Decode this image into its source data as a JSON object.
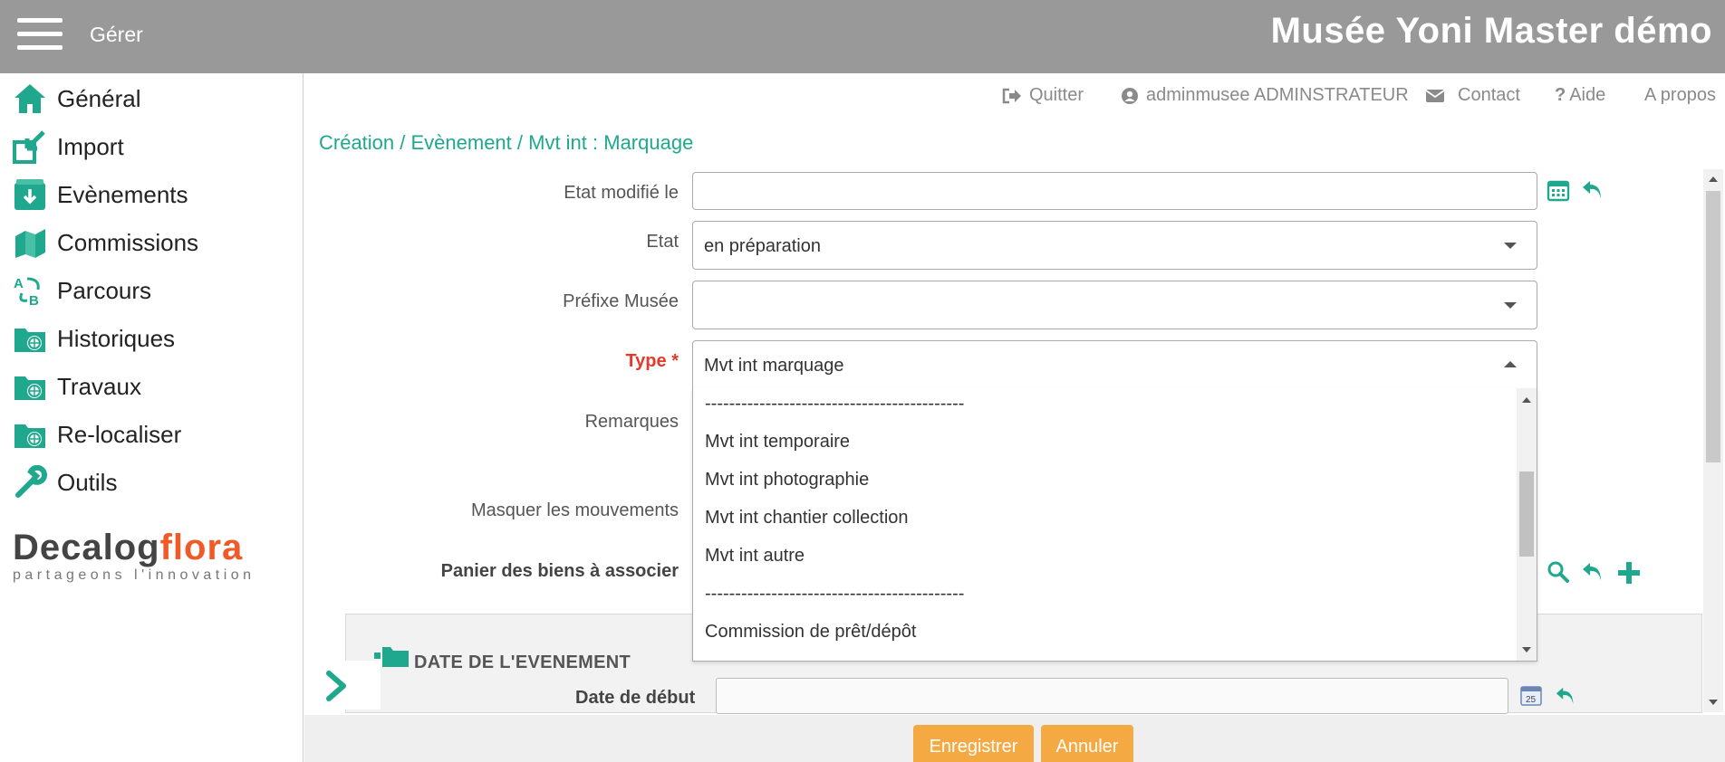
{
  "header": {
    "menu_label": "Gérer",
    "app_title": "Musée Yoni Master démo"
  },
  "sidebar": {
    "items": [
      {
        "label": "Général",
        "icon": "home-icon"
      },
      {
        "label": "Import",
        "icon": "import-icon"
      },
      {
        "label": "Evènements",
        "icon": "events-icon"
      },
      {
        "label": "Commissions",
        "icon": "commissions-icon"
      },
      {
        "label": "Parcours",
        "icon": "route-icon"
      },
      {
        "label": "Historiques",
        "icon": "history-folder-icon"
      },
      {
        "label": "Travaux",
        "icon": "works-folder-icon"
      },
      {
        "label": "Re-localiser",
        "icon": "relocate-folder-icon"
      },
      {
        "label": "Outils",
        "icon": "wrench-icon"
      }
    ],
    "logo": {
      "brand_dark": "Decalog",
      "brand_accent": "flora",
      "tagline": "partageons l'innovation"
    }
  },
  "toplinks": {
    "quit": "Quitter",
    "user": "adminmusee ADMINSTRATEUR",
    "contact": "Contact",
    "help": "Aide",
    "about": "A propos"
  },
  "breadcrumb": "Création / Evènement / Mvt int : Marquage",
  "form": {
    "state_modified_label": "Etat modifié le",
    "state_modified_value": "",
    "state_label": "Etat",
    "state_value": "en préparation",
    "prefix_label": "Préfixe Musée",
    "prefix_value": "",
    "type_label": "Type *",
    "type_value": "Mvt int marquage",
    "remarks_label": "Remarques",
    "hide_movements_label": "Masquer les mouvements",
    "basket_label": "Panier des biens à associer"
  },
  "dropdown": {
    "options": [
      "-------------------------------------------",
      "Mvt int temporaire",
      "Mvt int photographie",
      "Mvt int chantier collection",
      "Mvt int autre",
      "-------------------------------------------",
      "Commission de prêt/dépôt"
    ]
  },
  "section": {
    "title": "DATE DE L'EVENEMENT",
    "start_date_label": "Date de début"
  },
  "footer": {
    "save_label": "Enregistrer",
    "cancel_label": "Annuler"
  },
  "colors": {
    "accent": "#1fa88e",
    "header_bg": "#999999",
    "button": "#f5a943",
    "required": "#e53a2a",
    "logo_orange": "#ef5a28"
  }
}
